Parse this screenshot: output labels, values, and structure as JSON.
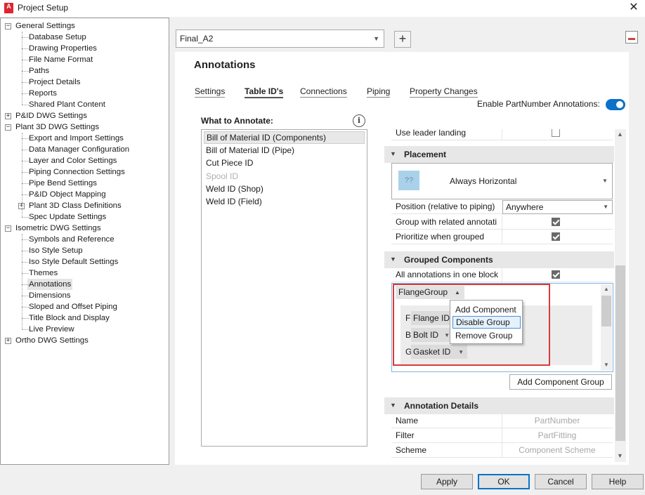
{
  "window": {
    "title": "Project Setup",
    "icon_label": "A",
    "close_glyph": "✕"
  },
  "tree": {
    "items": [
      {
        "label": "General Settings",
        "level": 0,
        "toggle": "−"
      },
      {
        "label": "Database Setup",
        "level": 1
      },
      {
        "label": "Drawing Properties",
        "level": 1
      },
      {
        "label": "File Name Format",
        "level": 1
      },
      {
        "label": "Paths",
        "level": 1
      },
      {
        "label": "Project Details",
        "level": 1
      },
      {
        "label": "Reports",
        "level": 1
      },
      {
        "label": "Shared Plant Content",
        "level": 1
      },
      {
        "label": "P&ID DWG Settings",
        "level": 0,
        "toggle": "+"
      },
      {
        "label": "Plant 3D DWG Settings",
        "level": 0,
        "toggle": "−"
      },
      {
        "label": "Export and Import Settings",
        "level": 1
      },
      {
        "label": "Data Manager Configuration",
        "level": 1
      },
      {
        "label": "Layer and Color Settings",
        "level": 1
      },
      {
        "label": "Piping Connection Settings",
        "level": 1
      },
      {
        "label": "Pipe Bend Settings",
        "level": 1
      },
      {
        "label": "P&ID Object Mapping",
        "level": 1
      },
      {
        "label": "Plant 3D Class Definitions",
        "level": 1,
        "toggle": "+"
      },
      {
        "label": "Spec Update Settings",
        "level": 1
      },
      {
        "label": "Isometric DWG Settings",
        "level": 0,
        "toggle": "−"
      },
      {
        "label": "Symbols and Reference",
        "level": 1
      },
      {
        "label": "Iso Style Setup",
        "level": 1
      },
      {
        "label": "Iso Style Default Settings",
        "level": 1
      },
      {
        "label": "Themes",
        "level": 1
      },
      {
        "label": "Annotations",
        "level": 1,
        "selected": true
      },
      {
        "label": "Dimensions",
        "level": 1
      },
      {
        "label": "Sloped and Offset Piping",
        "level": 1
      },
      {
        "label": "Title Block and Display",
        "level": 1
      },
      {
        "label": "Live Preview",
        "level": 1
      },
      {
        "label": "Ortho DWG Settings",
        "level": 0,
        "toggle": "+"
      }
    ]
  },
  "profile": {
    "selected": "Final_A2",
    "add_glyph": "+"
  },
  "page": {
    "title": "Annotations",
    "tabs": [
      {
        "label": "Settings",
        "active": false
      },
      {
        "label": "Table ID's",
        "active": true
      },
      {
        "label": "Connections",
        "active": false
      },
      {
        "label": "Piping",
        "active": false
      },
      {
        "label": "Property Changes",
        "active": false
      }
    ],
    "enable_label": "Enable PartNumber Annotations:",
    "enable_on": true
  },
  "what_to_annotate": {
    "label": "What to Annotate:",
    "info_glyph": "i",
    "items": [
      {
        "label": "Bill of Material ID (Components)",
        "selected": true,
        "disabled": false
      },
      {
        "label": "Bill of Material ID (Pipe)",
        "selected": false,
        "disabled": false
      },
      {
        "label": "Cut Piece ID",
        "selected": false,
        "disabled": false
      },
      {
        "label": "Spool ID",
        "selected": false,
        "disabled": true
      },
      {
        "label": "Weld ID (Shop)",
        "selected": false,
        "disabled": false
      },
      {
        "label": "Weld ID (Field)",
        "selected": false,
        "disabled": false
      }
    ]
  },
  "properties": {
    "use_leader_landing": {
      "label": "Use leader landing",
      "checked": false
    },
    "placement": {
      "category": "Placement",
      "swatch_text": "??",
      "orientation": "Always Horizontal",
      "position_label": "Position (relative to piping)",
      "position_value": "Anywhere",
      "group_related_label": "Group with related annotati",
      "group_related_checked": true,
      "prioritize_label": "Prioritize when grouped",
      "prioritize_checked": true
    },
    "grouped": {
      "category": "Grouped Components",
      "all_in_one_label": "All annotations in one block",
      "all_in_one_checked": true,
      "group_name": "FlangeGroup",
      "components": [
        {
          "letter": "F",
          "label": "Flange ID"
        },
        {
          "letter": "B",
          "label": "Bolt ID"
        },
        {
          "letter": "G",
          "label": "Gasket ID"
        }
      ],
      "context_menu": [
        "Add Component",
        "Disable Group",
        "Remove Group"
      ],
      "add_group_label": "Add Component Group"
    },
    "details": {
      "category": "Annotation Details",
      "rows": [
        {
          "label": "Name",
          "value": "PartNumber"
        },
        {
          "label": "Filter",
          "value": "PartFitting"
        },
        {
          "label": "Scheme",
          "value": "Component Scheme"
        }
      ]
    }
  },
  "buttons": {
    "apply": "Apply",
    "ok": "OK",
    "cancel": "Cancel",
    "help": "Help"
  }
}
